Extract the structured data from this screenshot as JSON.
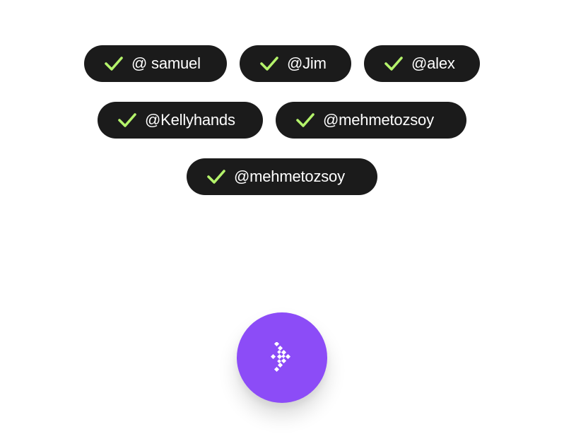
{
  "accent_color": "#8c4cf7",
  "check_color": "#b4f36b",
  "chip_color": "#1b1b1b",
  "tags": [
    {
      "label": "@ samuel",
      "icon": "check-icon"
    },
    {
      "label": "@Jim",
      "icon": "check-icon"
    },
    {
      "label": "@alex",
      "icon": "check-icon"
    },
    {
      "label": "@Kellyhands",
      "icon": "check-icon"
    },
    {
      "label": "@mehmetozsoy",
      "icon": "check-icon"
    },
    {
      "label": "@mehmetozsoy",
      "icon": "check-icon"
    }
  ],
  "submit_button": {
    "icon": "pixel-arrow-right-icon"
  }
}
